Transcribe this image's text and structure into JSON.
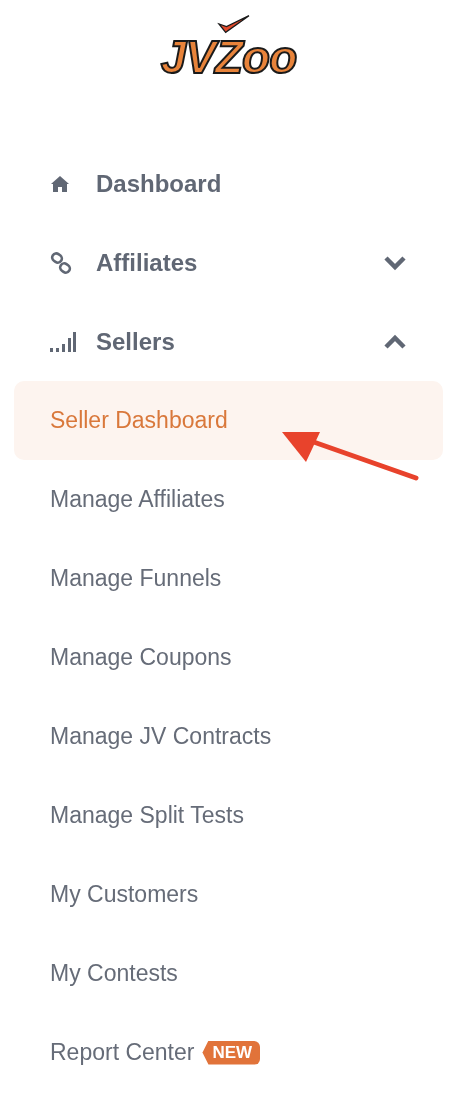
{
  "logo": {
    "text": "JVZoo"
  },
  "nav": [
    {
      "label": "Dashboard"
    },
    {
      "label": "Affiliates",
      "expanded": false
    },
    {
      "label": "Sellers",
      "expanded": true,
      "children": [
        {
          "label": "Seller Dashboard",
          "selected": true
        },
        {
          "label": "Manage Affiliates",
          "selected": false
        },
        {
          "label": "Manage Funnels",
          "selected": false
        },
        {
          "label": "Manage Coupons",
          "selected": false
        },
        {
          "label": "Manage JV Contracts",
          "selected": false
        },
        {
          "label": "Manage Split Tests",
          "selected": false
        },
        {
          "label": "My Customers",
          "selected": false
        },
        {
          "label": "My Contests",
          "selected": false
        },
        {
          "label": "Report Center",
          "selected": false,
          "badge": "NEW"
        }
      ]
    }
  ]
}
